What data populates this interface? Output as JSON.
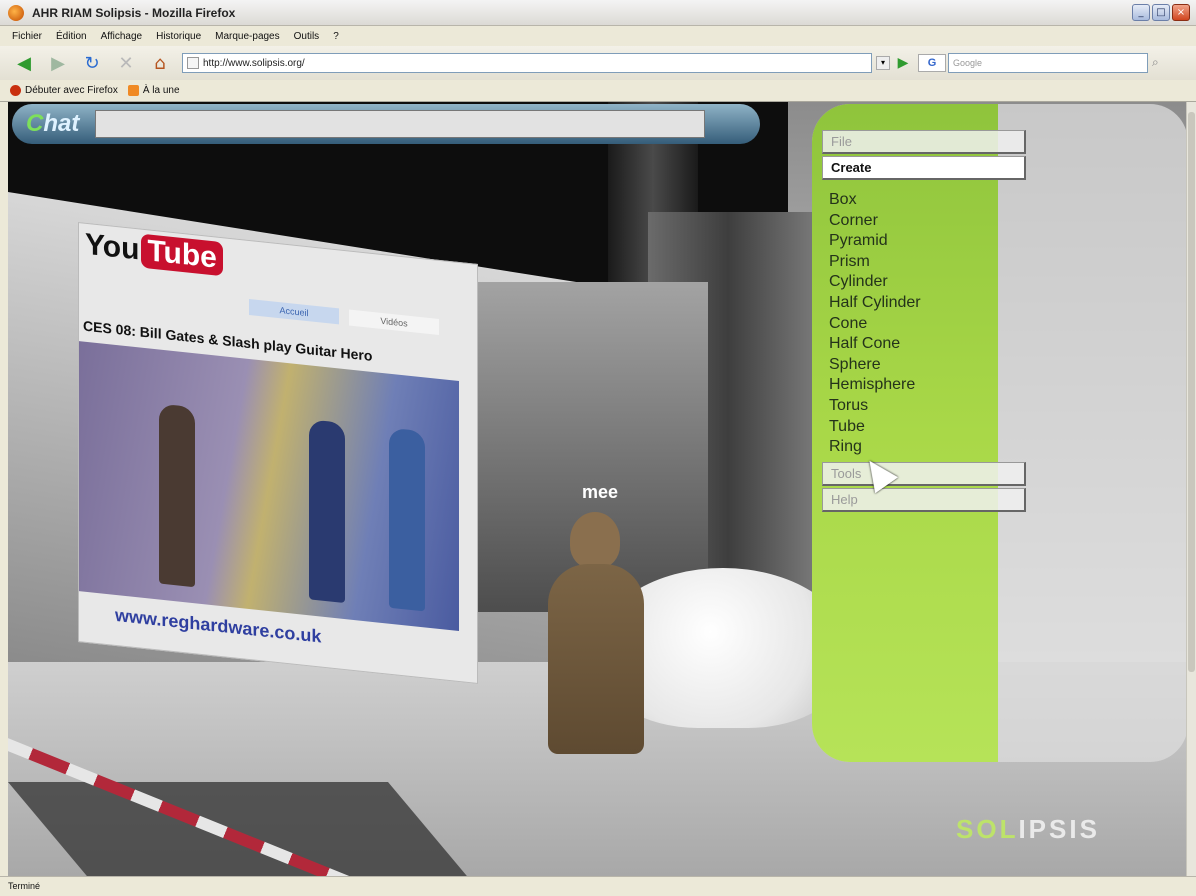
{
  "window": {
    "title": "AHR RIAM Solipsis - Mozilla Firefox",
    "controls": [
      "_",
      "□",
      "×"
    ]
  },
  "menubar": {
    "items": [
      "Fichier",
      "Édition",
      "Affichage",
      "Historique",
      "Marque-pages",
      "Outils",
      "?"
    ]
  },
  "navbar": {
    "url": "http://www.solipsis.org/",
    "search_engine": "G",
    "search_placeholder": "Google"
  },
  "bookmarks": {
    "items": [
      "Débuter avec Firefox",
      "À la une"
    ]
  },
  "chat": {
    "label_first": "C",
    "label_rest": "hat",
    "input_value": ""
  },
  "scene": {
    "youtube": {
      "logo_you": "You",
      "logo_tube": "Tube",
      "tab_active": "Accueil",
      "tab_other": "Vidéos",
      "headline": "CES 08: Bill Gates & Slash play Guitar Hero",
      "footer": "www.reghardware.co.uk"
    },
    "avatar_name": "mee"
  },
  "menu": {
    "file": "File",
    "create": "Create",
    "create_items": [
      "Box",
      "Corner",
      "Pyramid",
      "Prism",
      "Cylinder",
      "Half Cylinder",
      "Cone",
      "Half Cone",
      "Sphere",
      "Hemisphere",
      "Torus",
      "Tube",
      "Ring"
    ],
    "tools": "Tools",
    "help": "Help"
  },
  "logo": {
    "part1": "SOL",
    "part2": "IPSIS"
  },
  "status": {
    "text": "Terminé"
  },
  "colors": {
    "menu_green": "#a9d848",
    "chat_bar": "#355d79",
    "youtube_red": "#c8102e"
  }
}
